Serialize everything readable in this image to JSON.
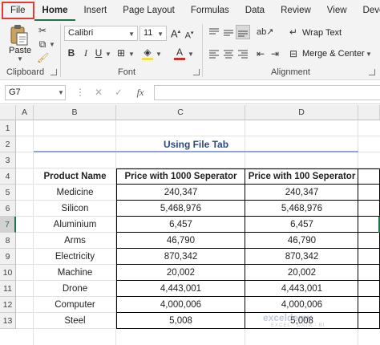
{
  "menu": {
    "tabs": [
      "File",
      "Home",
      "Insert",
      "Page Layout",
      "Formulas",
      "Data",
      "Review",
      "View",
      "Developer"
    ]
  },
  "ribbon": {
    "clipboard": {
      "paste_label": "Paste",
      "group_label": "Clipboard"
    },
    "font": {
      "name": "Calibri",
      "size": "11",
      "group_label": "Font",
      "bold": "B",
      "italic": "I",
      "underline": "U",
      "font_color_letter": "A"
    },
    "alignment": {
      "wrap_text": "Wrap Text",
      "merge_center": "Merge & Center",
      "group_label": "Alignment"
    }
  },
  "formula_bar": {
    "name_box": "G7",
    "fx": "fx",
    "cancel": "✕",
    "enter": "✓"
  },
  "columns": [
    "A",
    "B",
    "C",
    "D"
  ],
  "rows": [
    "1",
    "2",
    "3",
    "4",
    "5",
    "6",
    "7",
    "8",
    "9",
    "10",
    "11",
    "12",
    "13"
  ],
  "sheet": {
    "title": "Using File Tab",
    "headers": [
      "Product Name",
      "Price with 1000 Seperator",
      "Price with 100 Seperator"
    ],
    "data": [
      [
        "Medicine",
        "240,347",
        "240,347"
      ],
      [
        "Silicon",
        "5,468,976",
        "5,468,976"
      ],
      [
        "Aluminium",
        "6,457",
        "6,457"
      ],
      [
        "Arms",
        "46,790",
        "46,790"
      ],
      [
        "Electricity",
        "870,342",
        "870,342"
      ],
      [
        "Machine",
        "20,002",
        "20,002"
      ],
      [
        "Drone",
        "4,443,001",
        "4,443,001"
      ],
      [
        "Computer",
        "4,000,006",
        "4,000,006"
      ],
      [
        "Steel",
        "5,008",
        "5,008"
      ]
    ]
  },
  "watermark": {
    "name": "exceldemy",
    "tagline": "EXCEL · DATA · BI"
  },
  "colors": {
    "accent": "#217346",
    "file_highlight": "#e03c31",
    "title_text": "#2b4a78"
  }
}
